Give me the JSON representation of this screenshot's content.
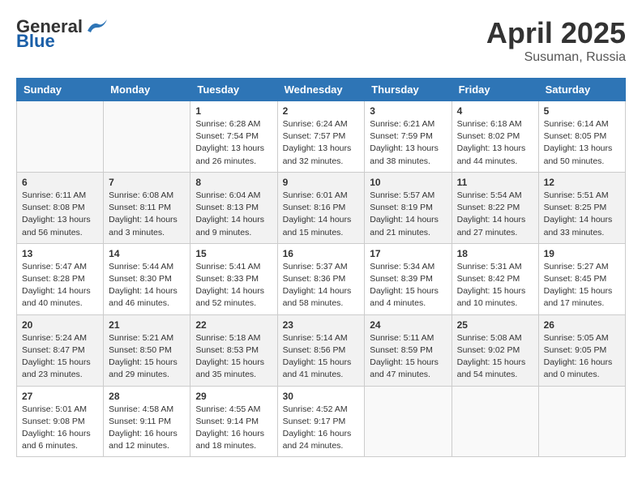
{
  "logo": {
    "general": "General",
    "blue": "Blue"
  },
  "title": {
    "month_year": "April 2025",
    "location": "Susuman, Russia"
  },
  "days_of_week": [
    "Sunday",
    "Monday",
    "Tuesday",
    "Wednesday",
    "Thursday",
    "Friday",
    "Saturday"
  ],
  "weeks": [
    [
      {
        "day": "",
        "info": ""
      },
      {
        "day": "",
        "info": ""
      },
      {
        "day": "1",
        "info": "Sunrise: 6:28 AM\nSunset: 7:54 PM\nDaylight: 13 hours and 26 minutes."
      },
      {
        "day": "2",
        "info": "Sunrise: 6:24 AM\nSunset: 7:57 PM\nDaylight: 13 hours and 32 minutes."
      },
      {
        "day": "3",
        "info": "Sunrise: 6:21 AM\nSunset: 7:59 PM\nDaylight: 13 hours and 38 minutes."
      },
      {
        "day": "4",
        "info": "Sunrise: 6:18 AM\nSunset: 8:02 PM\nDaylight: 13 hours and 44 minutes."
      },
      {
        "day": "5",
        "info": "Sunrise: 6:14 AM\nSunset: 8:05 PM\nDaylight: 13 hours and 50 minutes."
      }
    ],
    [
      {
        "day": "6",
        "info": "Sunrise: 6:11 AM\nSunset: 8:08 PM\nDaylight: 13 hours and 56 minutes."
      },
      {
        "day": "7",
        "info": "Sunrise: 6:08 AM\nSunset: 8:11 PM\nDaylight: 14 hours and 3 minutes."
      },
      {
        "day": "8",
        "info": "Sunrise: 6:04 AM\nSunset: 8:13 PM\nDaylight: 14 hours and 9 minutes."
      },
      {
        "day": "9",
        "info": "Sunrise: 6:01 AM\nSunset: 8:16 PM\nDaylight: 14 hours and 15 minutes."
      },
      {
        "day": "10",
        "info": "Sunrise: 5:57 AM\nSunset: 8:19 PM\nDaylight: 14 hours and 21 minutes."
      },
      {
        "day": "11",
        "info": "Sunrise: 5:54 AM\nSunset: 8:22 PM\nDaylight: 14 hours and 27 minutes."
      },
      {
        "day": "12",
        "info": "Sunrise: 5:51 AM\nSunset: 8:25 PM\nDaylight: 14 hours and 33 minutes."
      }
    ],
    [
      {
        "day": "13",
        "info": "Sunrise: 5:47 AM\nSunset: 8:28 PM\nDaylight: 14 hours and 40 minutes."
      },
      {
        "day": "14",
        "info": "Sunrise: 5:44 AM\nSunset: 8:30 PM\nDaylight: 14 hours and 46 minutes."
      },
      {
        "day": "15",
        "info": "Sunrise: 5:41 AM\nSunset: 8:33 PM\nDaylight: 14 hours and 52 minutes."
      },
      {
        "day": "16",
        "info": "Sunrise: 5:37 AM\nSunset: 8:36 PM\nDaylight: 14 hours and 58 minutes."
      },
      {
        "day": "17",
        "info": "Sunrise: 5:34 AM\nSunset: 8:39 PM\nDaylight: 15 hours and 4 minutes."
      },
      {
        "day": "18",
        "info": "Sunrise: 5:31 AM\nSunset: 8:42 PM\nDaylight: 15 hours and 10 minutes."
      },
      {
        "day": "19",
        "info": "Sunrise: 5:27 AM\nSunset: 8:45 PM\nDaylight: 15 hours and 17 minutes."
      }
    ],
    [
      {
        "day": "20",
        "info": "Sunrise: 5:24 AM\nSunset: 8:47 PM\nDaylight: 15 hours and 23 minutes."
      },
      {
        "day": "21",
        "info": "Sunrise: 5:21 AM\nSunset: 8:50 PM\nDaylight: 15 hours and 29 minutes."
      },
      {
        "day": "22",
        "info": "Sunrise: 5:18 AM\nSunset: 8:53 PM\nDaylight: 15 hours and 35 minutes."
      },
      {
        "day": "23",
        "info": "Sunrise: 5:14 AM\nSunset: 8:56 PM\nDaylight: 15 hours and 41 minutes."
      },
      {
        "day": "24",
        "info": "Sunrise: 5:11 AM\nSunset: 8:59 PM\nDaylight: 15 hours and 47 minutes."
      },
      {
        "day": "25",
        "info": "Sunrise: 5:08 AM\nSunset: 9:02 PM\nDaylight: 15 hours and 54 minutes."
      },
      {
        "day": "26",
        "info": "Sunrise: 5:05 AM\nSunset: 9:05 PM\nDaylight: 16 hours and 0 minutes."
      }
    ],
    [
      {
        "day": "27",
        "info": "Sunrise: 5:01 AM\nSunset: 9:08 PM\nDaylight: 16 hours and 6 minutes."
      },
      {
        "day": "28",
        "info": "Sunrise: 4:58 AM\nSunset: 9:11 PM\nDaylight: 16 hours and 12 minutes."
      },
      {
        "day": "29",
        "info": "Sunrise: 4:55 AM\nSunset: 9:14 PM\nDaylight: 16 hours and 18 minutes."
      },
      {
        "day": "30",
        "info": "Sunrise: 4:52 AM\nSunset: 9:17 PM\nDaylight: 16 hours and 24 minutes."
      },
      {
        "day": "",
        "info": ""
      },
      {
        "day": "",
        "info": ""
      },
      {
        "day": "",
        "info": ""
      }
    ]
  ]
}
